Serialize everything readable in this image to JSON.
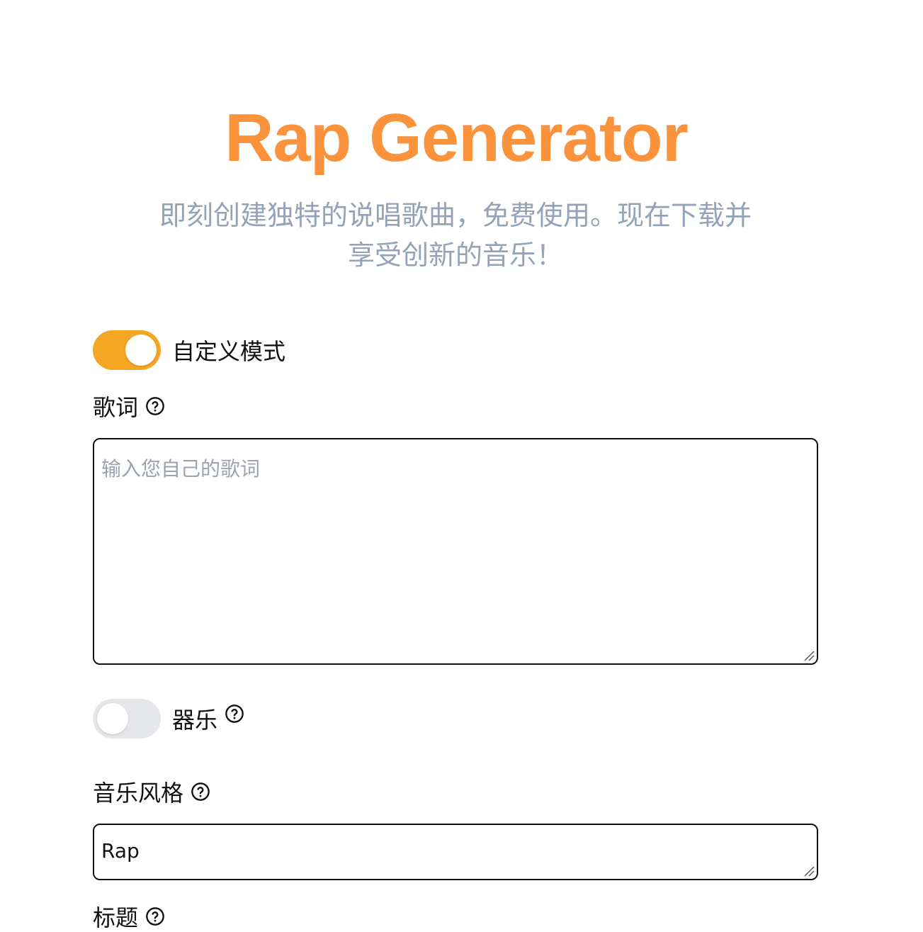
{
  "hero": {
    "title": "Rap Generator",
    "subtitle_line1": "即刻创建独特的说唱歌曲，免费使用。现在下载并",
    "subtitle_line2": "享受创新的音乐！",
    "title_color": "#fb923c",
    "subtitle_color": "#94a3b8"
  },
  "custom_mode": {
    "label": "自定义模式",
    "enabled": true,
    "accent_color": "#f5a623"
  },
  "lyrics": {
    "label": "歌词",
    "placeholder": "输入您自己的歌词",
    "value": "",
    "help_icon": "question-circle-icon"
  },
  "instrumental": {
    "label": "器乐",
    "enabled": false,
    "help_icon": "question-circle-icon"
  },
  "style": {
    "label": "音乐风格",
    "value": "Rap",
    "help_icon": "question-circle-icon"
  },
  "title_field": {
    "label": "标题",
    "help_icon": "question-circle-icon"
  }
}
